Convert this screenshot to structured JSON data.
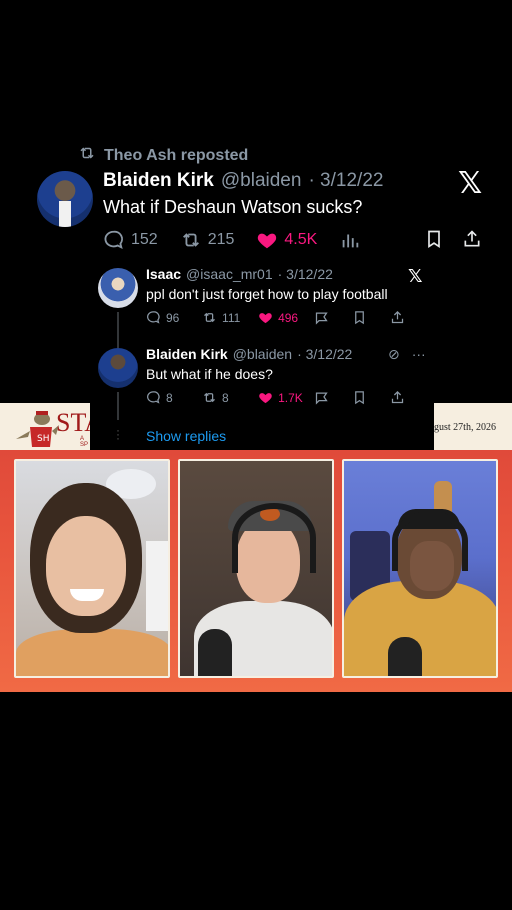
{
  "main_tweet": {
    "repost_label": "Theo Ash reposted",
    "author_name": "Blaiden Kirk",
    "author_handle": "@blaiden",
    "date": "· 3/12/22",
    "text": "What if Deshaun Watson sucks?",
    "replies": "152",
    "reposts": "215",
    "likes": "4.5K",
    "icons": [
      "repost-icon",
      "reply-icon",
      "like-icon",
      "views-icon",
      "bookmark-icon",
      "share-icon",
      "x-logo-icon"
    ]
  },
  "replies": [
    {
      "author_name": "Isaac",
      "author_handle": "@isaac_mr01",
      "date": "· 3/12/22",
      "text": "ppl don't just forget how to play football",
      "replies": "96",
      "reposts": "111",
      "likes": "496"
    },
    {
      "author_name": "Blaiden Kirk",
      "author_handle": "@blaiden",
      "date": "· 3/12/22",
      "text": "But what if he does?",
      "replies": "8",
      "reposts": "8",
      "likes": "1.7K"
    }
  ],
  "show_replies_label": "Show replies",
  "banner": {
    "left_text": "STA",
    "left_sub": "A SP",
    "right_text": "gust 27th, 2026"
  },
  "colors": {
    "like": "#f91880",
    "link": "#1d9bf0",
    "muted": "#8b98a5",
    "video_bg": "#e8553d"
  }
}
